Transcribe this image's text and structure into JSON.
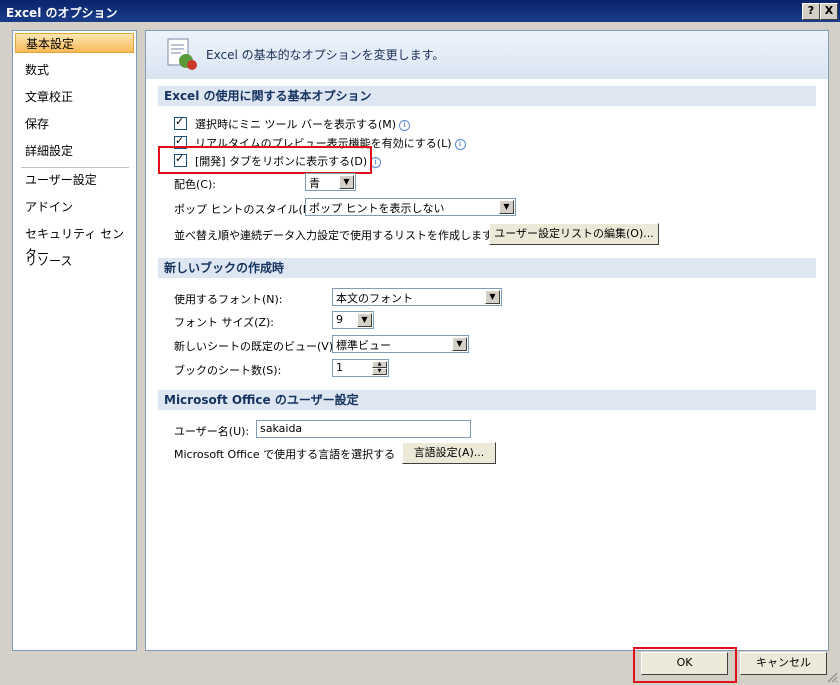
{
  "window": {
    "title": "Excel のオプション",
    "help_label": "?",
    "close_label": "X"
  },
  "nav": {
    "items": [
      "基本設定",
      "数式",
      "文章校正",
      "保存",
      "詳細設定",
      "ユーザー設定",
      "アドイン",
      "セキュリティ センター",
      "リソース"
    ],
    "selected": "基本設定"
  },
  "banner": {
    "text": "Excel の基本的なオプションを変更します。"
  },
  "section_basic": {
    "header": "Excel の使用に関する基本オプション",
    "options": [
      {
        "label": "選択時にミニ ツール バーを表示する(M)",
        "checked": true
      },
      {
        "label": "リアルタイムのプレビュー表示機能を有効にする(L)",
        "checked": true
      },
      {
        "label": "[開発] タブをリボンに表示する(D)",
        "checked": true
      }
    ],
    "color_label": "配色(C):",
    "color_value": "青",
    "tooltip_label": "ポップ ヒントのスタイル(R):",
    "tooltip_value": "ポップ ヒントを表示しない",
    "sortlist_label": "並べ替え順や連続データ入力設定で使用するリストを作成します:",
    "sortlist_button": "ユーザー設定リストの編集(O)..."
  },
  "section_newbook": {
    "header": "新しいブックの作成時",
    "font_label": "使用するフォント(N):",
    "font_value": "本文のフォント",
    "size_label": "フォント サイズ(Z):",
    "size_value": "9",
    "view_label": "新しいシートの既定のビュー(V):",
    "view_value": "標準ビュー",
    "sheets_label": "ブックのシート数(S):",
    "sheets_value": "1"
  },
  "section_user": {
    "header": "Microsoft Office のユーザー設定",
    "username_label": "ユーザー名(U):",
    "username_value": "sakaida",
    "language_label": "Microsoft Office で使用する言語を選択する",
    "language_button": "言語設定(A)..."
  },
  "footer": {
    "ok_label": "OK",
    "cancel_label": "キャンセル"
  },
  "icons": {
    "info": "i",
    "dropdown": "▼",
    "spin_up": "▲",
    "spin_down": "▼"
  },
  "colors": {
    "highlight_red": "#e0101a",
    "selection": "#f7b956",
    "section_bg": "#dde6f1"
  }
}
